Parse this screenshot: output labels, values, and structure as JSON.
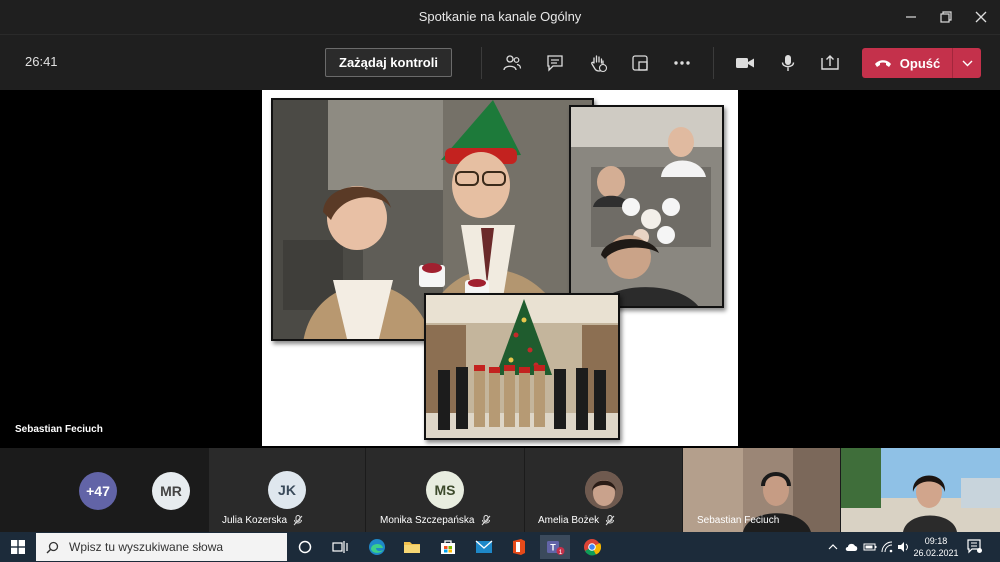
{
  "window": {
    "title": "Spotkanie na kanale Ogólny"
  },
  "toolbar": {
    "timer": "26:41",
    "request_control_label": "Zażądaj kontroli",
    "leave_label": "Opuść"
  },
  "stage": {
    "presenter_name": "Sebastian Feciuch"
  },
  "participants": {
    "overflow_count": "+47",
    "tiles": [
      {
        "initials": "MR",
        "name": "",
        "avatar_color": "#e7ecef",
        "text_color": "#444444"
      },
      {
        "initials": "JK",
        "name": "Julia Kozerska",
        "avatar_color": "#dfe7ee",
        "text_color": "#3a4a5a"
      },
      {
        "initials": "MS",
        "name": "Monika Szczepańska",
        "avatar_color": "#e8ede0",
        "text_color": "#3c4a2c"
      },
      {
        "initials": "",
        "name": "Amelia Bożek",
        "avatar_color": "#8a6f63",
        "text_color": "#ffffff"
      }
    ],
    "video_tiles": [
      {
        "name": "Sebastian Feciuch"
      },
      {
        "name": ""
      }
    ]
  },
  "taskbar": {
    "search_placeholder": "Wpisz tu wyszukiwane słowa",
    "time": "09:18",
    "date": "26.02.2021"
  },
  "colors": {
    "leave_red": "#c4314b",
    "teams_purple": "#6264a7",
    "taskbar_bg": "#1c2b3a"
  }
}
